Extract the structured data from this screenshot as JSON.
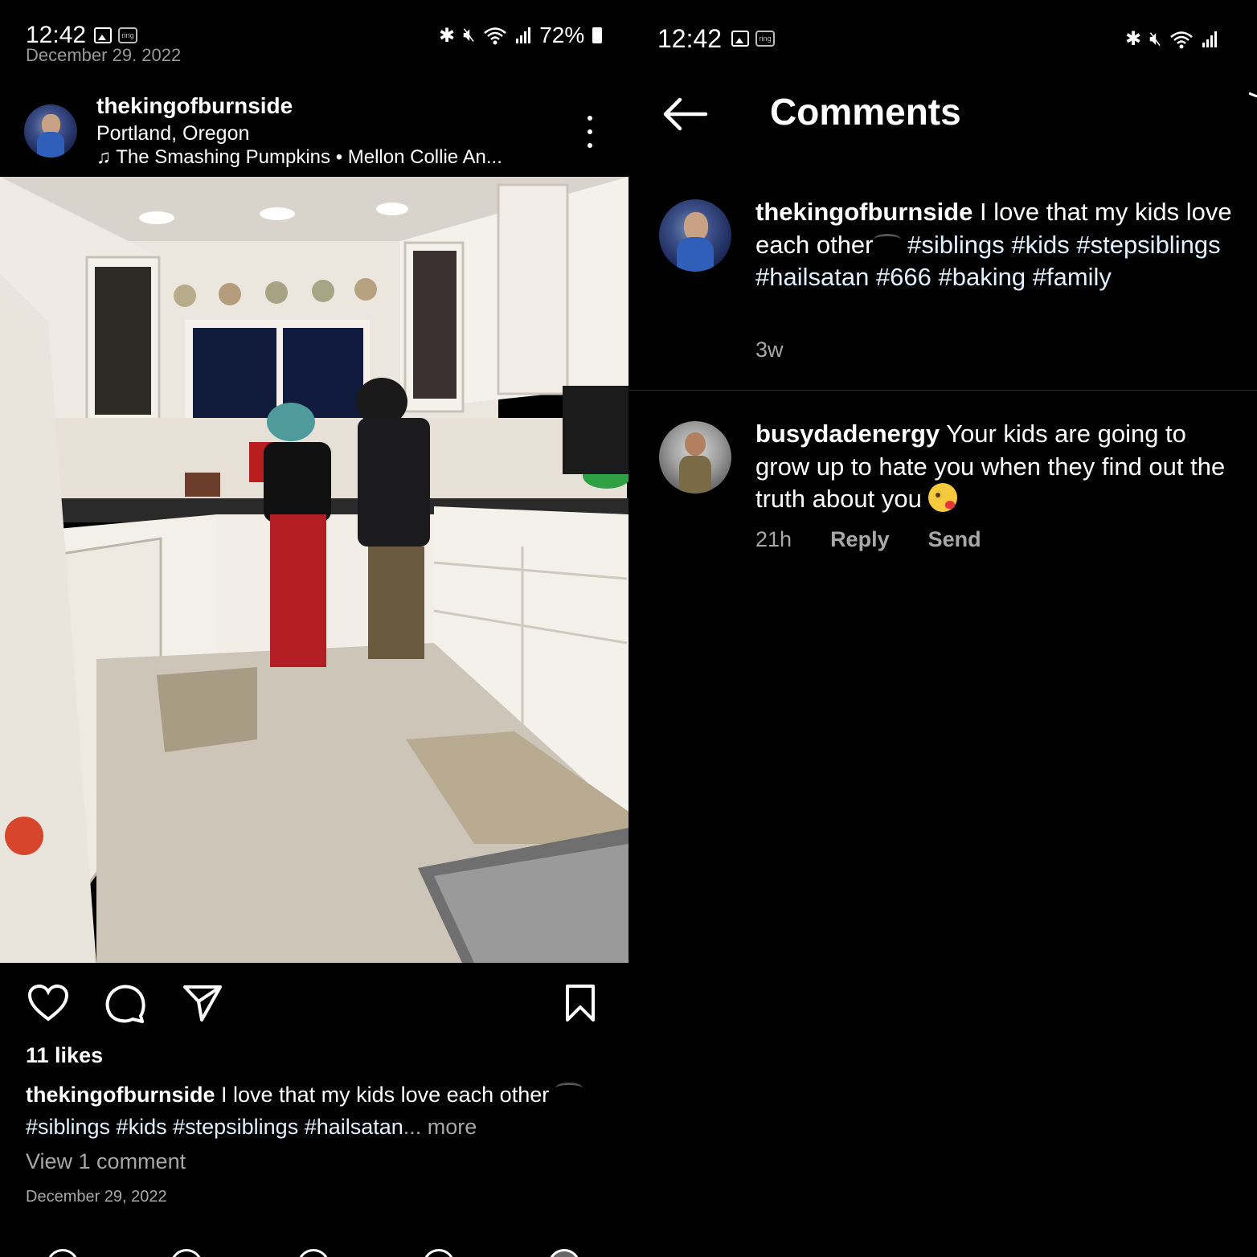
{
  "status_bar": {
    "time": "12:42",
    "battery": "72%",
    "icons": [
      "gallery-icon",
      "ring-icon",
      "bluetooth-icon",
      "mute-icon",
      "wifi-icon",
      "signal-icon",
      "battery-icon"
    ],
    "ring_label": "ring"
  },
  "post": {
    "scrolled_date": "December 29, 2022",
    "username": "thekingofburnside",
    "location": "Portland, Oregon",
    "music": "The Smashing Pumpkins • Mellon Collie An...",
    "likes": "11 likes",
    "caption": {
      "username": "thekingofburnside",
      "text": "I love that my kids love each other",
      "tags": "#siblings #kids #stepsiblings #hailsatan",
      "more": "... more"
    },
    "view_comments": "View 1 comment",
    "date": "December 29, 2022"
  },
  "comments_screen": {
    "title": "Comments",
    "comments": [
      {
        "username": "thekingofburnside",
        "text_a": "I love that my kids love each other",
        "tags": "#siblings #kids #stepsiblings #hailsatan #666 #baking #family",
        "age": "3w"
      },
      {
        "username": "busydadenergy",
        "text": "Your kids are going to grow up to hate you when they find out the truth about you",
        "age": "21h",
        "reply_label": "Reply",
        "send_label": "Send"
      }
    ]
  },
  "colors": {
    "background": "#000000",
    "secondary_text": "#a8a8a8",
    "hashtag": "#e0f1ff"
  }
}
